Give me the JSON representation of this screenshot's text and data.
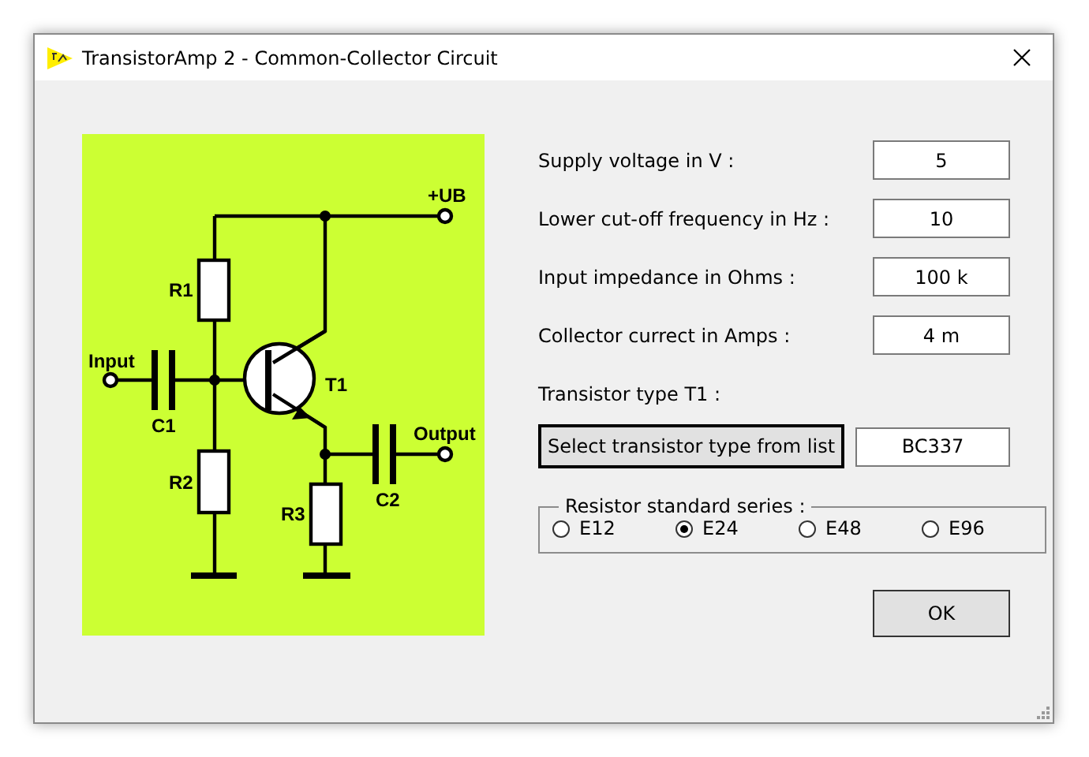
{
  "window": {
    "title": "TransistorAmp 2 - Common-Collector Circuit"
  },
  "diagram": {
    "supply": "+UB",
    "input": "Input",
    "output": "Output",
    "r1": "R1",
    "r2": "R2",
    "r3": "R3",
    "c1": "C1",
    "c2": "C2",
    "t1": "T1"
  },
  "fields": [
    {
      "label": "Supply voltage in V :",
      "value": "5"
    },
    {
      "label": "Lower cut-off frequency in Hz :",
      "value": "10"
    },
    {
      "label": "Input impedance in Ohms :",
      "value": "100 k"
    },
    {
      "label": "Collector currect in Amps :",
      "value": "4 m"
    }
  ],
  "transistor": {
    "label": "Transistor type T1 :",
    "button": "Select transistor type from list",
    "value": "BC337"
  },
  "resistor_series": {
    "title": "Resistor standard series :",
    "options": [
      {
        "label": "E12",
        "selected": false
      },
      {
        "label": "E24",
        "selected": true
      },
      {
        "label": "E48",
        "selected": false
      },
      {
        "label": "E96",
        "selected": false
      }
    ]
  },
  "ok_button": "OK"
}
